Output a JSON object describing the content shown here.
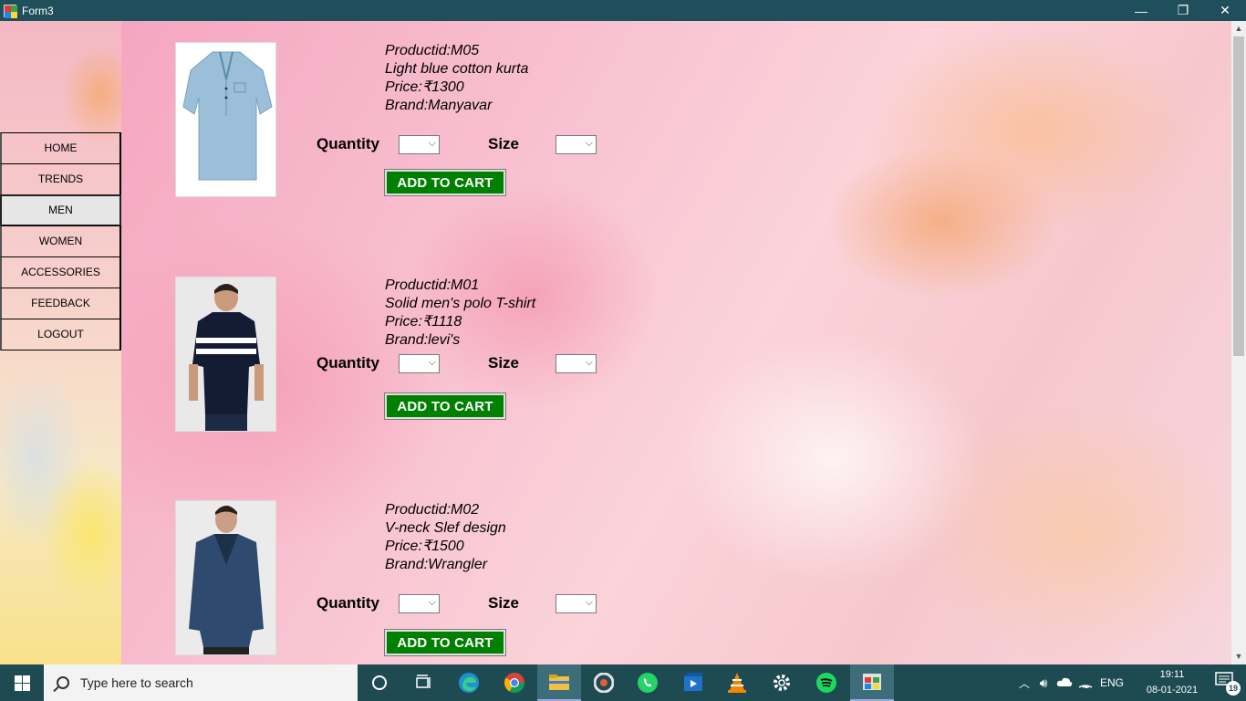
{
  "window": {
    "title": "Form3",
    "minimize_glyph": "—",
    "maximize_glyph": "❐",
    "close_glyph": "✕"
  },
  "nav": {
    "items": [
      {
        "label": "HOME",
        "active": false
      },
      {
        "label": "TRENDS",
        "active": false
      },
      {
        "label": "MEN",
        "active": true
      },
      {
        "label": "WOMEN",
        "active": false
      },
      {
        "label": "ACCESSORIES",
        "active": false
      },
      {
        "label": "FEEDBACK",
        "active": false
      },
      {
        "label": "LOGOUT",
        "active": false
      }
    ]
  },
  "labels": {
    "quantity": "Quantity",
    "size": "Size",
    "add_to_cart": "ADD TO CART"
  },
  "products": [
    {
      "id": "Productid:M05",
      "name": "Light blue cotton kurta",
      "price": "Price:₹1300",
      "brand": "Brand:Manyavar",
      "image": "light-blue-kurta"
    },
    {
      "id": "Productid:M01",
      "name": "Solid men's polo T-shirt",
      "price": "Price:₹1118",
      "brand": "Brand:levi's",
      "image": "navy-striped-polo"
    },
    {
      "id": "Productid:M02",
      "name": "V-neck Slef design",
      "price": "Price:₹1500",
      "brand": "Brand:Wrangler",
      "image": "blue-v-neck-sweater"
    }
  ],
  "taskbar": {
    "search_placeholder": "Type here to search",
    "language": "ENG",
    "time": "19:11",
    "date": "08-01-2021",
    "notification_count": "19",
    "apps": [
      "cortana-icon",
      "task-view-icon",
      "edge-icon",
      "chrome-icon",
      "file-explorer-icon",
      "groove-music-icon",
      "whatsapp-icon",
      "movies-tv-icon",
      "vlc-icon",
      "settings-icon",
      "spotify-icon",
      "form-app-icon"
    ]
  },
  "colors": {
    "titlebar": "#1e4f5a",
    "taskbar": "#1e4a52",
    "cart_button": "#008000"
  }
}
